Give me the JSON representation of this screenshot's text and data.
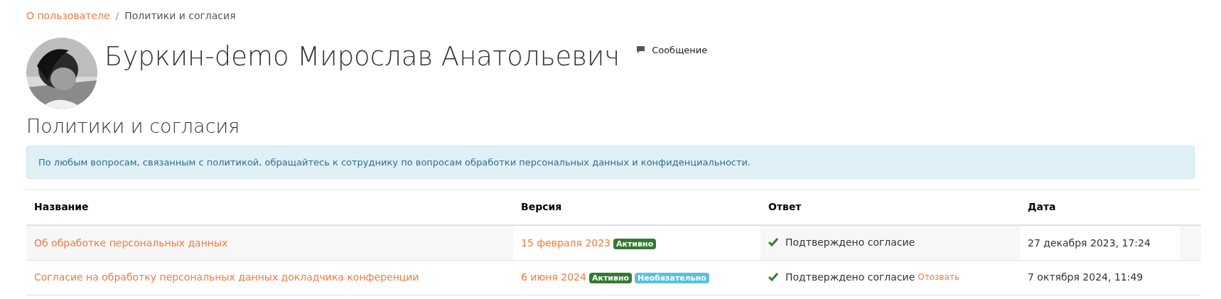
{
  "breadcrumb": {
    "separator": "/",
    "items": [
      {
        "label": "О пользователе",
        "link": true
      },
      {
        "label": "Политики и согласия",
        "link": false
      }
    ]
  },
  "profile": {
    "name": "Буркин-demo Мирослав Анатольевич",
    "message_link": "Сообщение"
  },
  "heading": "Политики и согласия",
  "alert": "По любым вопросам, связанным с политикой, обращайтесь к сотруднику по вопросам обработки персональных данных и конфиденциальности.",
  "table": {
    "columns": [
      "Название",
      "Версия",
      "Ответ",
      "Дата"
    ],
    "rows": [
      {
        "name": "Об обработке персональных данных",
        "version": "15 февраля 2023",
        "badges": [
          {
            "label": "Активно",
            "kind": "success"
          }
        ],
        "answer": "Подтверждено согласие",
        "accepted": true,
        "revoke": null,
        "date": "27 декабря 2023, 17:24"
      },
      {
        "name": "Согласие на обработку персональных данных докладчика конференции",
        "version": "6 июня 2024",
        "badges": [
          {
            "label": "Активно",
            "kind": "success"
          },
          {
            "label": "Необязательно",
            "kind": "info"
          }
        ],
        "answer": "Подтверждено согласие",
        "accepted": true,
        "revoke": "Отозвать",
        "date": "7 октября 2024, 11:49"
      }
    ]
  }
}
